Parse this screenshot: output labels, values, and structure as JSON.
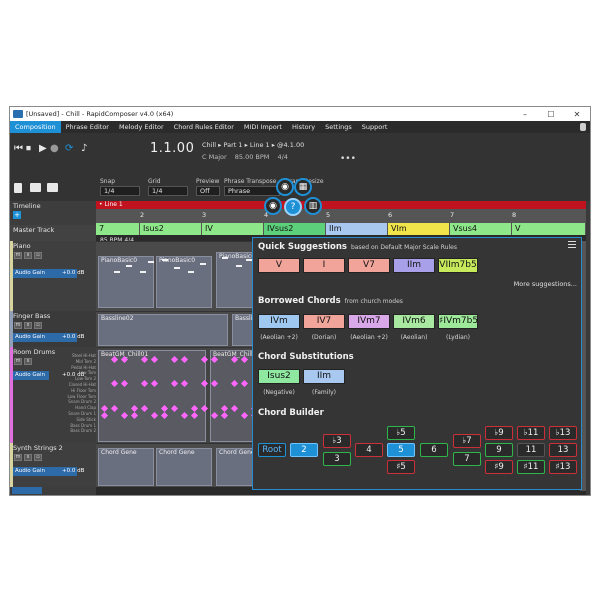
{
  "window": {
    "title": "[Unsaved] - Chill - RapidComposer v4.0 (x64)",
    "controls": [
      "–",
      "☐",
      "✕"
    ]
  },
  "menu": {
    "items": [
      "Composition",
      "Phrase Editor",
      "Melody Editor",
      "Chord Rules Editor",
      "MIDI Import",
      "History",
      "Settings",
      "Support"
    ],
    "active": "Composition"
  },
  "transport": {
    "position": "1.1.00",
    "breadcrumb": "Chill ▸ Part 1 ▸ Line 1 ▸ @4.1.00",
    "key": "C Major",
    "tempo": "85.00 BPM",
    "meter": "4/4",
    "more": "•••"
  },
  "toolbar": {
    "snap_label": "Snap",
    "snap_value": "1/4",
    "grid_label": "Grid",
    "grid_value": "1/4",
    "preview_label": "Preview",
    "preview_value": "Off",
    "transpose_label": "Phrase Transpose",
    "transpose_value": "Phrase",
    "resize_label": "Phrase Resize"
  },
  "timeline": {
    "label": "Timeline",
    "line_label": "• Line 1",
    "bars": [
      "2",
      "3",
      "4",
      "5",
      "6",
      "7",
      "8"
    ],
    "bpm_text": "85 BPM  4/4"
  },
  "chord_track": [
    "7",
    "Isus2",
    "IV",
    "IVsus2",
    "IIm",
    "VIm",
    "Vsus4",
    "V"
  ],
  "tracks": [
    {
      "name": "Master Track"
    },
    {
      "name": "Piano",
      "gain": "Audio Gain",
      "gain_value": "+0.0 dB",
      "clip1": "PianoBasic0",
      "clip2": "PianoBasic0",
      "clip3": "PianoBasic0"
    },
    {
      "name": "Finger Bass",
      "gain": "Audio Gain",
      "gain_value": "+0.0 dB",
      "clip1": "Bassline02",
      "clip2": "Bassline02"
    },
    {
      "name": "Room Drums",
      "gain": "Audio Gain",
      "gain_value": "+0.0 dB",
      "clip1": "BeatGM_Chill01",
      "clip2": "BeatGM_Chill01"
    },
    {
      "name": "Synth Strings 2",
      "gain": "Audio Gain",
      "gain_value": "+0.0 dB",
      "clip1": "Chord Gene",
      "clip2": "Chord Gene",
      "clip3": "Chord Gene"
    }
  ],
  "drum_rows": [
    "Steel Hi-Hat",
    "Mid Tom 2",
    "Pedal Hi-Hat",
    "Low Tom",
    "Low-Tom 2",
    "Closed Hi-Hat",
    "Hi Floor Tom",
    "Low Floor Tom",
    "Snare Drum 2",
    "Hand Clap",
    "Snare Drum 1",
    "Side Stick",
    "Bass Drum 1",
    "Bass Drum 2"
  ],
  "popup": {
    "quick_title": "Quick Suggestions",
    "quick_sub": "based on  Default Major Scale Rules",
    "quick_chips": [
      {
        "label": "V",
        "color": "#f0a49a"
      },
      {
        "label": "I",
        "color": "#f0a49a"
      },
      {
        "label": "V7",
        "color": "#f0a49a"
      },
      {
        "label": "IIm",
        "color": "#a8a0e8"
      },
      {
        "label": "VIIm7b5",
        "color": "#c7ea5c"
      }
    ],
    "more_suggestions": "More suggestions...",
    "borrowed_title": "Borrowed Chords",
    "borrowed_sub": "from  church modes",
    "borrowed_chips": [
      {
        "label": "IVm",
        "note": "(Aeolian +2)",
        "color": "#9fc8f0"
      },
      {
        "label": "IV7",
        "note": "(Dorian)",
        "color": "#f0a49a"
      },
      {
        "label": "IVm7",
        "note": "(Aeolian +2)",
        "color": "#d8a8e8"
      },
      {
        "label": "IVm6",
        "note": "(Aeolian)",
        "color": "#a8e8a0"
      },
      {
        "label": "♯IVm7b5",
        "note": "(Lydian)",
        "color": "#9ee89a"
      }
    ],
    "subs_title": "Chord Substitutions",
    "subs_chips": [
      {
        "label": "Isus2",
        "note": "(Negative)",
        "color": "#8ee8a0"
      },
      {
        "label": "IIm",
        "note": "(Family)",
        "color": "#a8c8f0"
      }
    ],
    "builder_title": "Chord Builder",
    "builder": {
      "root": "Root",
      "b2": "2",
      "b3": "♭3",
      "b3b": "3",
      "b4": "4",
      "b5a": "♭5",
      "b5": "5",
      "b5c": "♯5",
      "b6": "6",
      "b7a": "♭7",
      "b7": "7",
      "b9a": "♭9",
      "b9": "9",
      "b9c": "♯9",
      "b11a": "♭11",
      "b11": "11",
      "b11c": "♯11",
      "b13a": "♭13",
      "b13": "13",
      "b13c": "♯13"
    }
  },
  "fabs": {
    "help": "?"
  }
}
